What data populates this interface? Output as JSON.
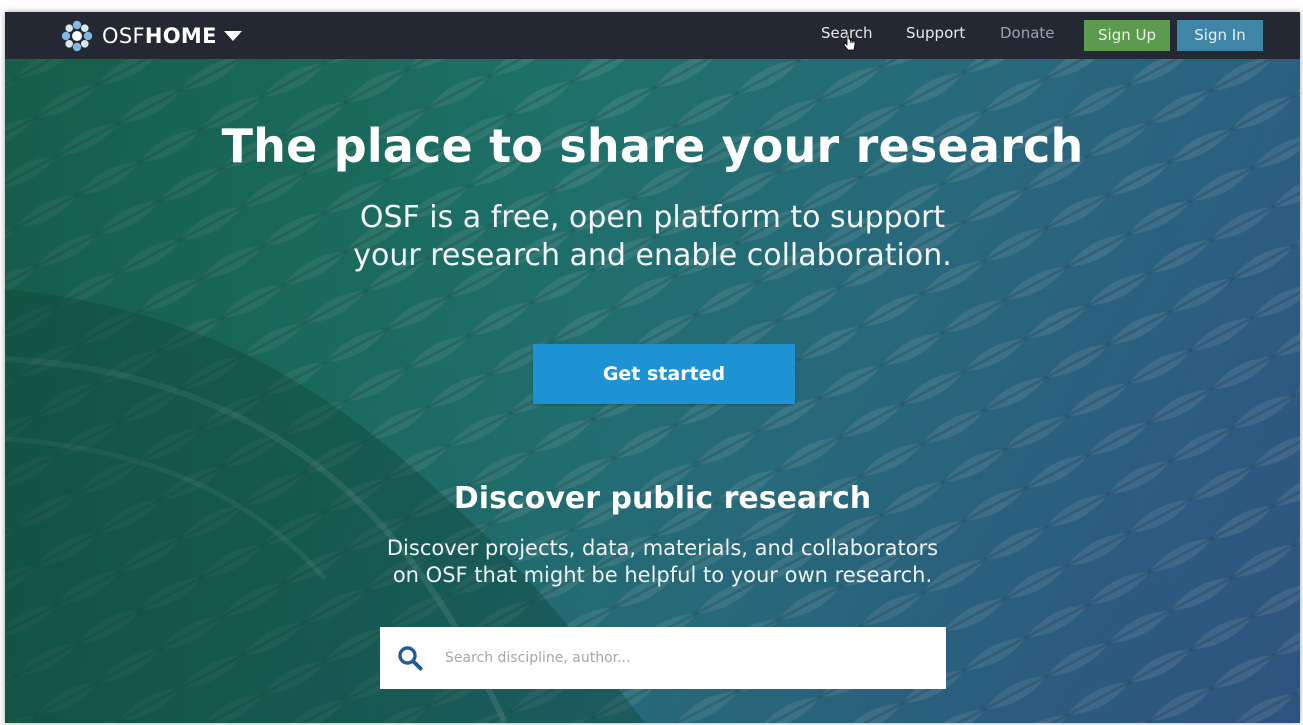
{
  "brand": {
    "name_light": "OSF",
    "name_bold": "HOME",
    "logo_icon": "osf-flower-logo-icon",
    "dropdown_icon": "caret-down-icon"
  },
  "nav": {
    "search_label": "Search",
    "support_label": "Support",
    "donate_label": "Donate",
    "signup_label": "Sign Up",
    "signin_label": "Sign In"
  },
  "hero": {
    "title": "The place to share your research",
    "subtitle_line1": "OSF is a free, open platform to support",
    "subtitle_line2": "your research and enable collaboration.",
    "cta_label": "Get started"
  },
  "discover": {
    "title": "Discover public research",
    "text_line1": "Discover projects, data, materials, and collaborators",
    "text_line2": "on OSF that might be helpful to your own research.",
    "search_placeholder": "Search discipline, author...",
    "search_icon": "search-icon"
  },
  "colors": {
    "navbar_bg": "#232833",
    "signup_bg": "#5c9b4d",
    "signin_bg": "#3f86a6",
    "cta_bg": "#1e93d3",
    "search_icon": "#1f5c99"
  }
}
